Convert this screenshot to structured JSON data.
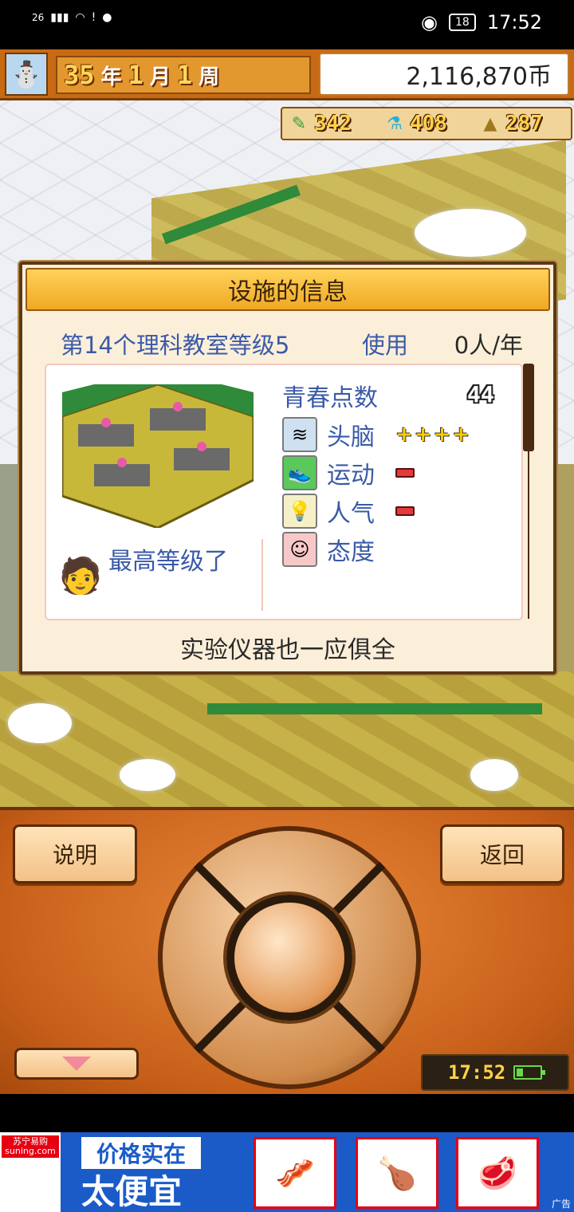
{
  "status_bar": {
    "signal": "26",
    "battery": "18",
    "time": "17:52"
  },
  "hud": {
    "avatar_icon": "snowman-icon",
    "year_num": "35",
    "year_unit": "年",
    "month_num": "1",
    "month_unit": "月",
    "week_num": "1",
    "week_unit": "周",
    "money": "2,116,870币",
    "resources": [
      {
        "icon": "pencil-icon",
        "value": "342"
      },
      {
        "icon": "flask-icon",
        "value": "408"
      },
      {
        "icon": "bell-icon",
        "value": "287"
      }
    ]
  },
  "dialog": {
    "title": "设施的信息",
    "facility_name": "第14个理科教室等级5",
    "use_label": "使用",
    "use_rate": "0人/年",
    "youth_points_label": "青春点数",
    "youth_points_value": "44",
    "max_level_text": "最高等级了",
    "stats": [
      {
        "icon": "brain-icon",
        "label": "头脑",
        "rating": "++++",
        "level": 4
      },
      {
        "icon": "shoe-icon",
        "label": "运动",
        "rating": "-",
        "level": -1
      },
      {
        "icon": "lightbulb-icon",
        "label": "人气",
        "rating": "-",
        "level": -1
      },
      {
        "icon": "smiley-icon",
        "label": "态度",
        "rating": "",
        "level": 0
      }
    ],
    "description": "实验仪器也一应俱全"
  },
  "controller": {
    "help_label": "说明",
    "back_label": "返回",
    "game_clock": "17:52"
  },
  "ad": {
    "brand_cn": "苏宁易购",
    "brand_url": "suning.com",
    "headline": "价格实在",
    "subheadline": "太便宜",
    "tag": "广告"
  },
  "colors": {
    "hud_orange": "#c86a14",
    "dialog_bg": "#fcefd9",
    "title_yellow": "#f0a824",
    "text_blue": "#3a5aa8",
    "ad_blue": "#1a5bc8"
  }
}
